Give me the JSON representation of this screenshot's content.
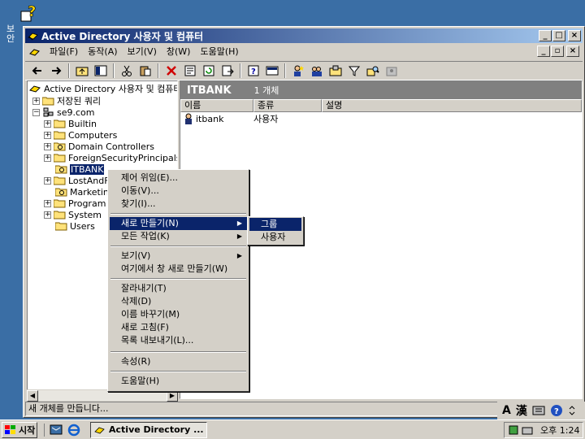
{
  "desktop": {
    "icon_label": "보안"
  },
  "window": {
    "title": "Active Directory 사용자 및 컴퓨터"
  },
  "menubar": {
    "items": [
      "파일(F)",
      "동작(A)",
      "보기(V)",
      "창(W)",
      "도움말(H)"
    ]
  },
  "tree": {
    "root": "Active Directory 사용자 및 컴퓨터",
    "saved_queries": "저장된 쿼리",
    "domain": "se9.com",
    "children": [
      "Builtin",
      "Computers",
      "Domain Controllers",
      "ForeignSecurityPrincipals",
      "ITBANK",
      "LostAndFound",
      "Marketing",
      "Program Data",
      "System",
      "Users"
    ]
  },
  "details": {
    "header": "ITBANK",
    "count": "1 개체",
    "columns": [
      "이름",
      "종류",
      "설명"
    ],
    "rows": [
      {
        "name": "itbank",
        "type": "사용자",
        "desc": ""
      }
    ]
  },
  "context_menu": {
    "items": [
      "제어 위임(E)...",
      "이동(V)...",
      "찾기(I)...",
      "새로 만들기(N)",
      "모든 작업(K)",
      "보기(V)",
      "여기에서 창 새로 만들기(W)",
      "잘라내기(T)",
      "삭제(D)",
      "이름 바꾸기(M)",
      "새로 고침(F)",
      "목록 내보내기(L)...",
      "속성(R)",
      "도움말(H)"
    ],
    "highlighted": "새로 만들기(N)"
  },
  "submenu": {
    "items": [
      "그룹",
      "사용자"
    ],
    "highlighted": "그룹"
  },
  "status": {
    "text": "새 개체를 만듭니다..."
  },
  "ime": {
    "a": "A",
    "han": "漢"
  },
  "taskbar": {
    "start": "시작",
    "task": "Active Directory ...",
    "clock": "오후 1:24"
  },
  "colors": {
    "selection": "#0a246a",
    "desktop": "#3a6ea5",
    "chrome": "#d4d0c8"
  }
}
